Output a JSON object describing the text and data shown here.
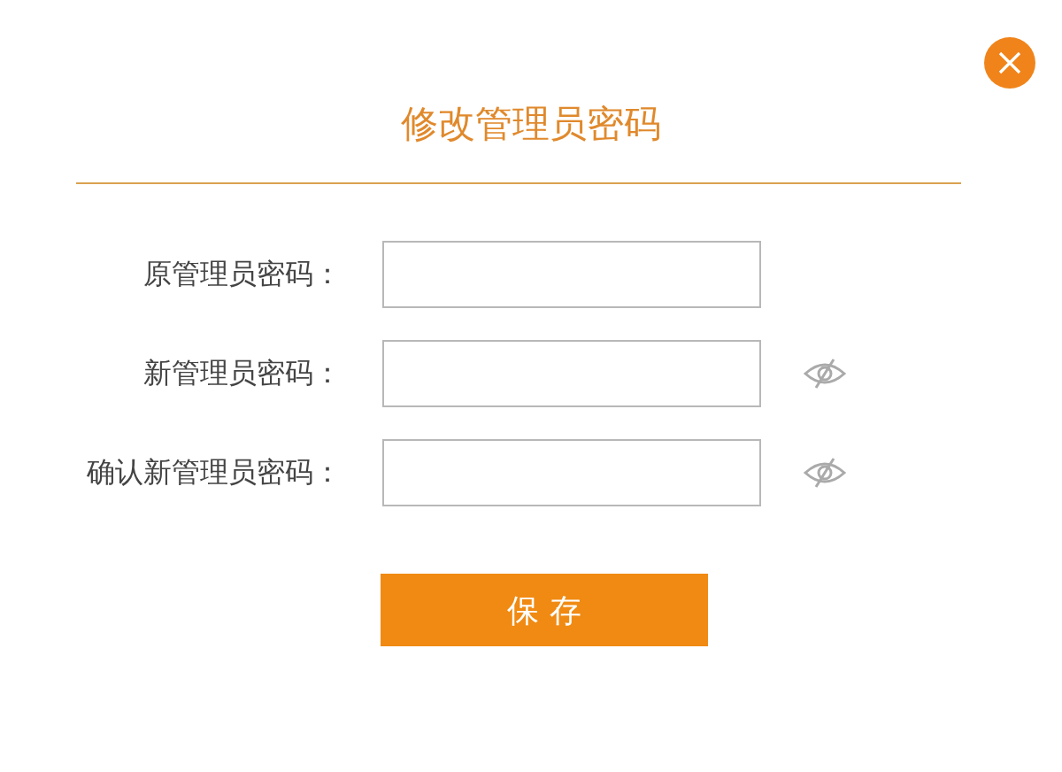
{
  "dialog": {
    "title": "修改管理员密码"
  },
  "fields": [
    {
      "label": "原管理员密码：",
      "reveal_toggle": false
    },
    {
      "label": "新管理员密码：",
      "reveal_toggle": true
    },
    {
      "label": "确认新管理员密码：",
      "reveal_toggle": true
    }
  ],
  "save_button": "保 存"
}
